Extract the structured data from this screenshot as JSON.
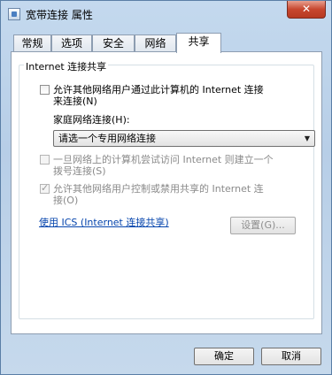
{
  "window": {
    "title": "宽带连接 属性",
    "close_glyph": "✕"
  },
  "tabs": [
    {
      "label": "常规"
    },
    {
      "label": "选项"
    },
    {
      "label": "安全"
    },
    {
      "label": "网络"
    },
    {
      "label": "共享"
    }
  ],
  "active_tab": "共享",
  "group": {
    "label": "Internet 连接共享",
    "allow_sharing": {
      "line1": "允许其他网络用户通过此计算机的 Internet 连接",
      "line2": "来连接(N)",
      "checked": false
    },
    "home_network_label": "家庭网络连接(H):",
    "home_network_select": {
      "value": "请选一个专用网络连接",
      "arrow": "▼"
    },
    "dial_on_demand": {
      "line1": "一旦网络上的计算机尝试访问 Internet 则建立一个",
      "line2": "拨号连接(S)",
      "checked": false,
      "disabled": true
    },
    "allow_control": {
      "line1": "允许其他网络用户控制或禁用共享的 Internet 连",
      "line2": "接(O)",
      "checked": true,
      "disabled": true
    },
    "ics_link": "使用 ICS (Internet 连接共享)",
    "settings_button": "设置(G)..."
  },
  "footer": {
    "ok_button": "确定",
    "cancel_button": "取消"
  }
}
